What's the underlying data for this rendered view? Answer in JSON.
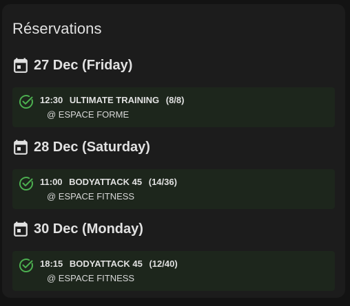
{
  "card": {
    "title": "Réservations"
  },
  "days": [
    {
      "title": "27 Dec (Friday)",
      "booking": {
        "time": "12:30",
        "activity": "ULTIMATE TRAINING",
        "spots": "(8/8)",
        "location": "@ ESPACE FORME"
      }
    },
    {
      "title": "28 Dec (Saturday)",
      "booking": {
        "time": "11:00",
        "activity": "BODYATTACK 45",
        "spots": "(14/36)",
        "location": "@ ESPACE FITNESS"
      }
    },
    {
      "title": "30 Dec (Monday)",
      "booking": {
        "time": "18:15",
        "activity": "BODYATTACK 45",
        "spots": "(12/40)",
        "location": "@ ESPACE FITNESS"
      }
    }
  ],
  "icons": {
    "day": "calendar-icon",
    "booking": "check-circle-icon"
  },
  "colors": {
    "card_bg": "#1c1c1c",
    "booking_bg": "#1d261c",
    "check": "#4caf50",
    "text": "#e1e1e1"
  }
}
